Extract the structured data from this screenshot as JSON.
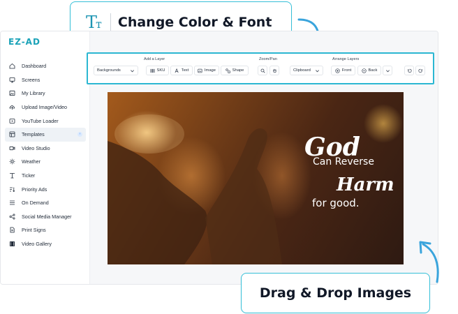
{
  "callouts": {
    "top": {
      "label": "Change Color & Font",
      "icon": "Tт"
    },
    "bottom": {
      "label": "Drag & Drop Images"
    }
  },
  "app": {
    "logo": "EZ-AD"
  },
  "sidebar": {
    "items": [
      {
        "label": "Dashboard",
        "icon": "home-icon"
      },
      {
        "label": "Screens",
        "icon": "monitor-icon"
      },
      {
        "label": "My Library",
        "icon": "image-icon"
      },
      {
        "label": "Upload Image/Video",
        "icon": "cloud-upload-icon"
      },
      {
        "label": "YouTube Loader",
        "icon": "play-icon"
      },
      {
        "label": "Templates",
        "icon": "template-icon",
        "active": true
      },
      {
        "label": "Video Studio",
        "icon": "video-icon"
      },
      {
        "label": "Weather",
        "icon": "sun-icon"
      },
      {
        "label": "Ticker",
        "icon": "ticker-icon"
      },
      {
        "label": "Priority Ads",
        "icon": "sort-icon"
      },
      {
        "label": "On Demand",
        "icon": "menu-icon"
      },
      {
        "label": "Social Media Manager",
        "icon": "share-icon"
      },
      {
        "label": "Print Signs",
        "icon": "doc-icon"
      },
      {
        "label": "Video Gallery",
        "icon": "film-icon"
      }
    ]
  },
  "toolbar": {
    "add_layer_label": "Add a Layer",
    "zoom_pan_label": "Zoom/Pan",
    "arrange_label": "Arrange Layers",
    "backgrounds": "Backgrounds",
    "sku": "SKU",
    "text": "Text",
    "image": "Image",
    "shape": "Shape",
    "clipboard": "Clipboard",
    "front": "Front",
    "back": "Back"
  },
  "canvas": {
    "line1": "God",
    "line2": "Can Reverse",
    "line3": "Harm",
    "line4": "for good."
  }
}
